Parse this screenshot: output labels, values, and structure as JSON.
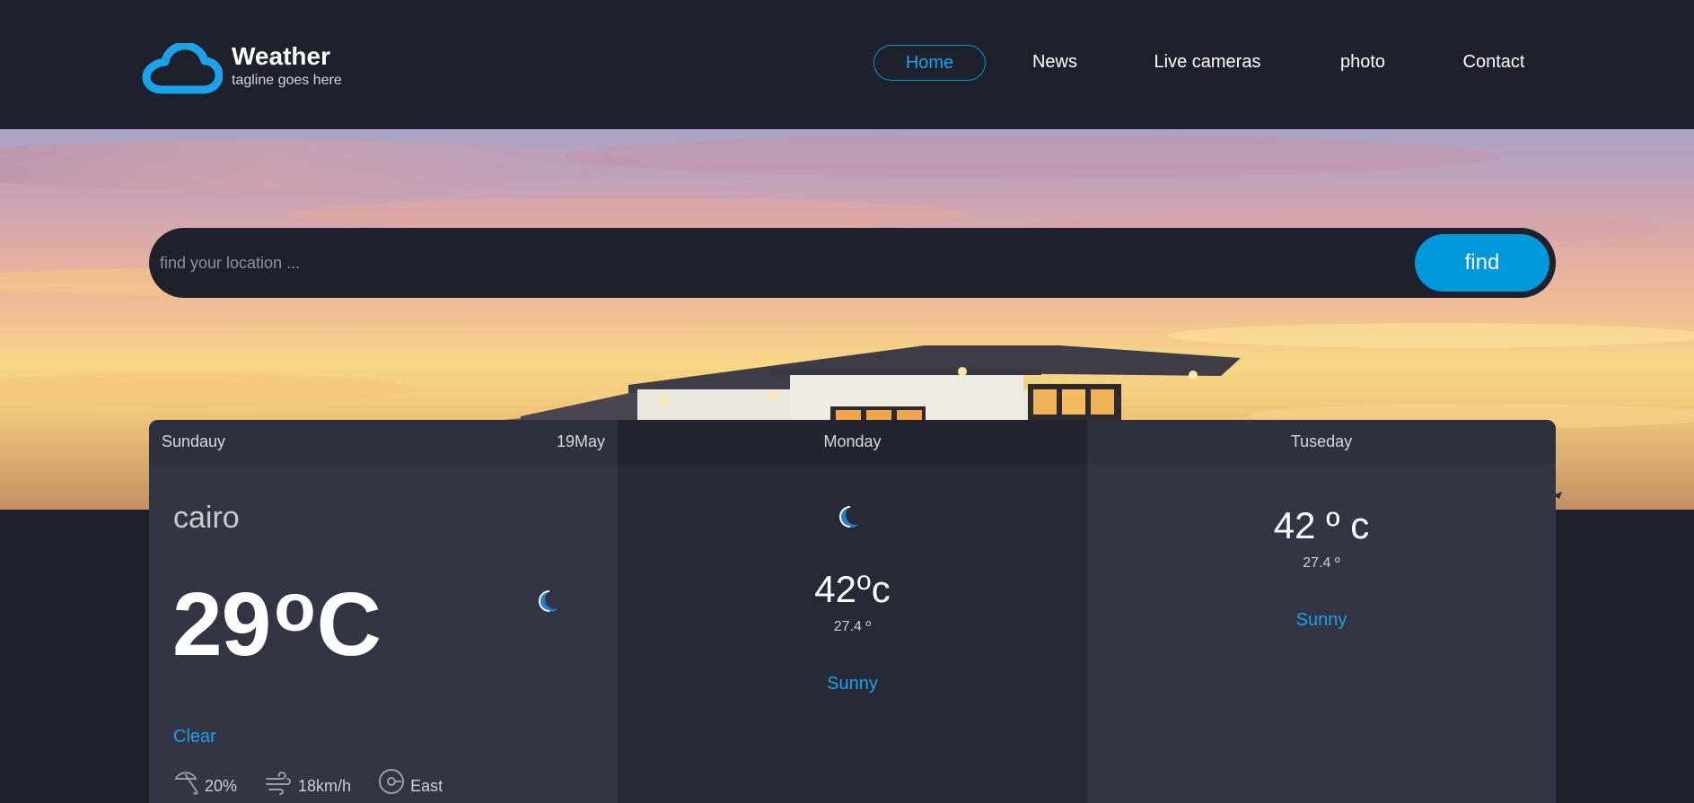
{
  "brand": {
    "title": "Weather",
    "tagline": "tagline goes here",
    "logo_icon": "cloud-icon",
    "logo_color": "#1aa3e8"
  },
  "nav": {
    "items": [
      {
        "label": "Home",
        "active": true
      },
      {
        "label": "News",
        "active": false
      },
      {
        "label": "Live cameras",
        "active": false
      },
      {
        "label": "photo",
        "active": false
      },
      {
        "label": "Contact",
        "active": false
      }
    ]
  },
  "search": {
    "placeholder": "find your location ...",
    "value": "",
    "button_label": "find"
  },
  "forecast": {
    "today": {
      "day": "Sundauy",
      "date": "19May",
      "location": "cairo",
      "temp_value": "29",
      "temp_degree": "o",
      "temp_unit": "C",
      "icon": "moon-icon",
      "condition": "Clear",
      "humidity": "20%",
      "humidity_icon": "umbrella-icon",
      "wind_speed": "18km/h",
      "wind_icon": "wind-icon",
      "wind_direction": "East",
      "compass_icon": "compass-icon"
    },
    "next": [
      {
        "day": "Monday",
        "icon": "moon-icon",
        "max_value": "42",
        "max_degree": "o",
        "max_unit": "c",
        "min_temp": "27.4 º",
        "condition": "Sunny"
      },
      {
        "day": "Tuseday",
        "max_temp": "42 º c",
        "min_temp": "27.4 º",
        "condition": "Sunny"
      }
    ]
  },
  "colors": {
    "background": "#1e202b",
    "accent": "#0098dd",
    "card_light": "#323544",
    "card_dark": "#262936"
  }
}
